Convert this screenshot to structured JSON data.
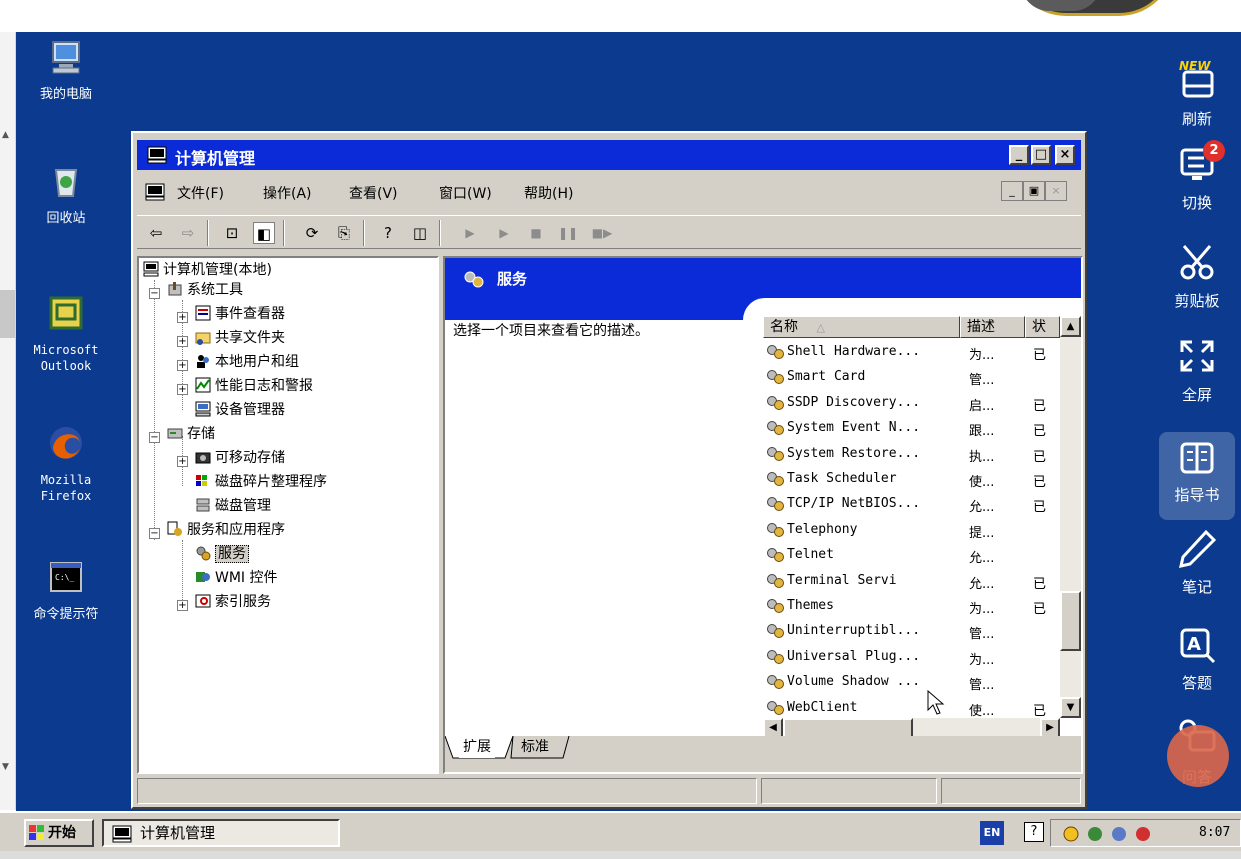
{
  "desktop": {
    "icons": [
      {
        "label": "我的电脑"
      },
      {
        "label": "回收站"
      },
      {
        "label": "Microsoft\nOutlook"
      },
      {
        "label": "Mozilla\nFirefox"
      },
      {
        "label": "命令提示符"
      }
    ]
  },
  "window": {
    "title": "计算机管理",
    "controls": {
      "minimize": "_",
      "maximize": "□",
      "close": "×"
    },
    "menu": [
      "文件(F)",
      "操作(A)",
      "查看(V)",
      "窗口(W)",
      "帮助(H)"
    ],
    "tree": {
      "root": "计算机管理(本地)",
      "system_tools": "系统工具",
      "event_viewer": "事件查看器",
      "shared_folders": "共享文件夹",
      "local_users": "本地用户和组",
      "perf_logs": "性能日志和警报",
      "device_manager": "设备管理器",
      "storage": "存储",
      "removable_storage": "可移动存储",
      "defrag": "磁盘碎片整理程序",
      "disk_management": "磁盘管理",
      "services_apps": "服务和应用程序",
      "services": "服务",
      "wmi": "WMI 控件",
      "indexing": "索引服务"
    },
    "pane": {
      "title": "服务",
      "description": "选择一个项目来查看它的描述。",
      "columns": {
        "name": "名称",
        "sort_indicator": "△",
        "desc": "描述",
        "status": "状"
      },
      "rows": [
        {
          "name": "Shell Hardware...",
          "desc": "为...",
          "status": "已"
        },
        {
          "name": "Smart Card",
          "desc": "管...",
          "status": ""
        },
        {
          "name": "SSDP Discovery...",
          "desc": "启...",
          "status": "已"
        },
        {
          "name": "System Event N...",
          "desc": "跟...",
          "status": "已"
        },
        {
          "name": "System Restore...",
          "desc": "执...",
          "status": "已"
        },
        {
          "name": "Task Scheduler",
          "desc": "使...",
          "status": "已"
        },
        {
          "name": "TCP/IP NetBIOS...",
          "desc": "允...",
          "status": "已"
        },
        {
          "name": "Telephony",
          "desc": "提...",
          "status": ""
        },
        {
          "name": "Telnet",
          "desc": "允...",
          "status": ""
        },
        {
          "name": "Terminal Servi",
          "desc": "允...",
          "status": "已"
        },
        {
          "name": "Themes",
          "desc": "为...",
          "status": "已"
        },
        {
          "name": "Uninterruptibl...",
          "desc": "管...",
          "status": ""
        },
        {
          "name": "Universal Plug...",
          "desc": "为...",
          "status": ""
        },
        {
          "name": "Volume Shadow ...",
          "desc": "管...",
          "status": ""
        },
        {
          "name": "WebClient",
          "desc": "使...",
          "status": "已"
        }
      ],
      "tabs": [
        "扩展",
        "标准"
      ]
    }
  },
  "sidebar": {
    "items": [
      {
        "label": "刷新",
        "icon": "new-refresh-icon",
        "tag": "NEW"
      },
      {
        "label": "切换",
        "icon": "switch-screen-icon",
        "badge": "2"
      },
      {
        "label": "剪贴板",
        "icon": "scissors-icon"
      },
      {
        "label": "全屏",
        "icon": "fullscreen-icon"
      },
      {
        "label": "指导书",
        "icon": "book-icon"
      },
      {
        "label": "笔记",
        "icon": "pencil-icon"
      },
      {
        "label": "答题",
        "icon": "answer-icon"
      },
      {
        "label": "问答",
        "icon": "qa-icon"
      }
    ]
  },
  "taskbar": {
    "start": "开始",
    "task": "计算机管理",
    "lang": "EN",
    "clock": "8:07"
  },
  "colors": {
    "desktop": "#0b3a8e",
    "titlebar": "#0b2ad8",
    "chrome": "#d4d0c8"
  }
}
